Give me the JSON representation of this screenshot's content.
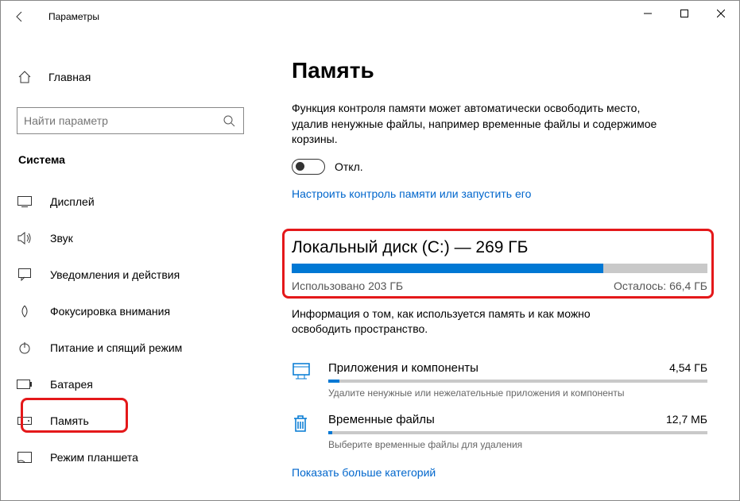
{
  "window": {
    "title": "Параметры"
  },
  "sidebar": {
    "home": "Главная",
    "search_placeholder": "Найти параметр",
    "section": "Система",
    "items": [
      {
        "label": "Дисплей"
      },
      {
        "label": "Звук"
      },
      {
        "label": "Уведомления и действия"
      },
      {
        "label": "Фокусировка внимания"
      },
      {
        "label": "Питание и спящий режим"
      },
      {
        "label": "Батарея"
      },
      {
        "label": "Память"
      },
      {
        "label": "Режим планшета"
      }
    ]
  },
  "main": {
    "title": "Память",
    "desc": "Функция контроля памяти может автоматически освободить место, удалив ненужные файлы, например временные файлы и содержимое корзины.",
    "toggle_label": "Откл.",
    "configure_link": "Настроить контроль памяти или запустить его",
    "disk": {
      "title": "Локальный диск (C:) — 269 ГБ",
      "used_label": "Использовано 203 ГБ",
      "free_label": "Осталось: 66,4 ГБ",
      "used_pct": 75
    },
    "disk_info": "Информация о том, как используется память и как можно освободить пространство.",
    "categories": [
      {
        "name": "Приложения и компоненты",
        "size": "4,54 ГБ",
        "sub": "Удалите ненужные или нежелательные приложения и компоненты",
        "pct": 3
      },
      {
        "name": "Временные файлы",
        "size": "12,7 МБ",
        "sub": "Выберите временные файлы для удаления",
        "pct": 1
      }
    ],
    "more_link": "Показать больше категорий"
  }
}
